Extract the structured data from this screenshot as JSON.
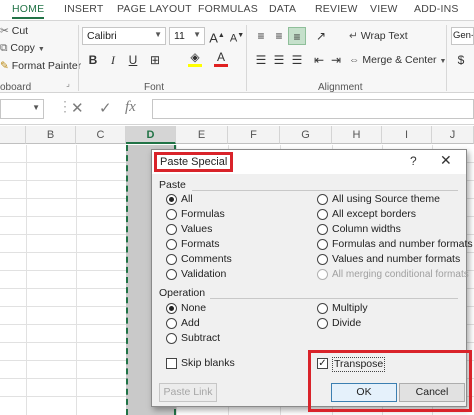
{
  "ribbon_tabs": [
    "HOME",
    "INSERT",
    "PAGE LAYOUT",
    "FORMULAS",
    "DATA",
    "REVIEW",
    "VIEW",
    "ADD-INS"
  ],
  "clipboard": {
    "cut": "Cut",
    "copy": "Copy",
    "format_painter": "Format Painter",
    "group_label": "oboard"
  },
  "font": {
    "family": "Calibri",
    "size": "11",
    "group_label": "Font",
    "bold": "B",
    "italic": "I",
    "underline": "U"
  },
  "alignment": {
    "wrap_text": "Wrap Text",
    "merge_center": "Merge & Center",
    "group_label": "Alignment"
  },
  "number": {
    "format": "Gen-"
  },
  "formula_bar": {
    "fx": "fx"
  },
  "columns": [
    "B",
    "C",
    "D",
    "E",
    "F",
    "G",
    "H",
    "I",
    "J"
  ],
  "dialog": {
    "title": "Paste Special",
    "help": "?",
    "close": "✕",
    "paste_section": "Paste",
    "paste_left": [
      {
        "label": "All",
        "selected": true
      },
      {
        "label": "Formulas",
        "selected": false
      },
      {
        "label": "Values",
        "selected": false
      },
      {
        "label": "Formats",
        "selected": false
      },
      {
        "label": "Comments",
        "selected": false
      },
      {
        "label": "Validation",
        "selected": false
      }
    ],
    "paste_right": [
      {
        "label": "All using Source theme",
        "selected": false
      },
      {
        "label": "All except borders",
        "selected": false
      },
      {
        "label": "Column widths",
        "selected": false
      },
      {
        "label": "Formulas and number formats",
        "selected": false
      },
      {
        "label": "Values and number formats",
        "selected": false
      },
      {
        "label": "All merging conditional formats",
        "selected": false
      }
    ],
    "operation_section": "Operation",
    "op_left": [
      {
        "label": "None",
        "selected": true
      },
      {
        "label": "Add",
        "selected": false
      },
      {
        "label": "Subtract",
        "selected": false
      }
    ],
    "op_right": [
      {
        "label": "Multiply",
        "selected": false
      },
      {
        "label": "Divide",
        "selected": false
      }
    ],
    "skip_blanks": "Skip blanks",
    "transpose": "Transpose",
    "paste_link": "Paste Link",
    "ok": "OK",
    "cancel": "Cancel"
  },
  "colors": {
    "accent_green": "#217346",
    "highlight_red": "#d9232a"
  }
}
